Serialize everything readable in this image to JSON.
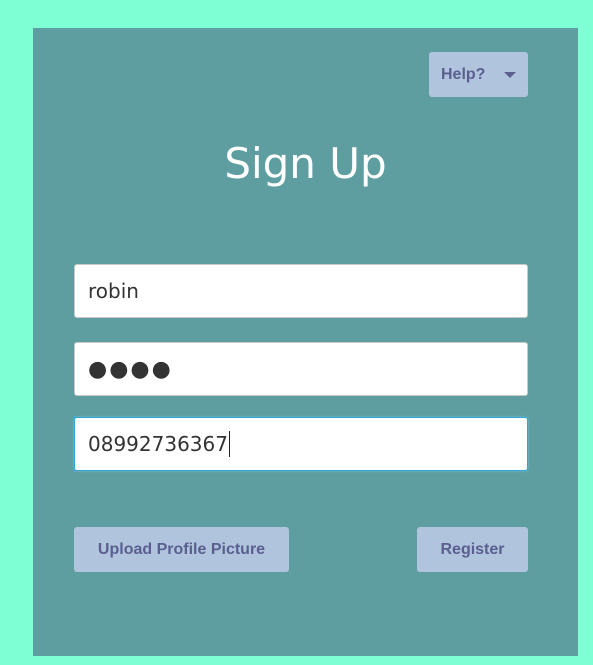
{
  "help": {
    "label": "Help?",
    "icon": "caret-down-icon"
  },
  "title": "Sign Up",
  "form": {
    "username_value": "robin",
    "password_display": "●●●●",
    "phone_value": "08992736367"
  },
  "buttons": {
    "upload_label": "Upload Profile Picture",
    "register_label": "Register"
  },
  "colors": {
    "background": "#7fffd4",
    "panel": "#5f9ea0",
    "button": "#b0c4de",
    "button_text": "#5a5f8f"
  }
}
